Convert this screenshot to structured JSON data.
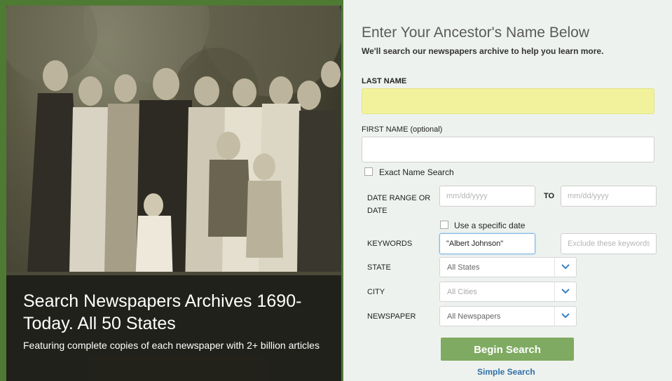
{
  "promo": {
    "title": "Search Newspapers Archives 1690-Today. All 50 States",
    "subtitle": "Featuring complete copies of each newspaper with 2+ billion articles"
  },
  "form": {
    "title": "Enter Your Ancestor's Name Below",
    "subtitle": "We'll search our newspapers archive to help you learn more.",
    "last_name_label": "LAST NAME",
    "last_name_value": "",
    "first_name_label": "FIRST NAME (optional)",
    "first_name_value": "",
    "exact_name_label": "Exact Name Search",
    "exact_name_checked": false,
    "date_range_label": "DATE RANGE OR DATE",
    "date_from_placeholder": "mm/dd/yyyy",
    "to_label": "TO",
    "date_to_placeholder": "mm/dd/yyyy",
    "specific_date_label": "Use a specific date",
    "specific_date_checked": false,
    "keywords_label": "KEYWORDS",
    "keywords_value": "\"Albert Johnson\"",
    "exclude_placeholder": "Exclude these keywords",
    "state_label": "STATE",
    "state_value": "All States",
    "city_label": "CITY",
    "city_value": "All Cities",
    "newspaper_label": "NEWSPAPER",
    "newspaper_value": "All Newspapers",
    "search_button": "Begin Search",
    "simple_search_link": "Simple Search"
  },
  "colors": {
    "frame_green": "#4e7a33",
    "button_green": "#7faa61",
    "last_name_highlight": "#f2f29c",
    "link_blue": "#2f6fa6"
  },
  "icons": [
    "chevron-down-icon"
  ]
}
